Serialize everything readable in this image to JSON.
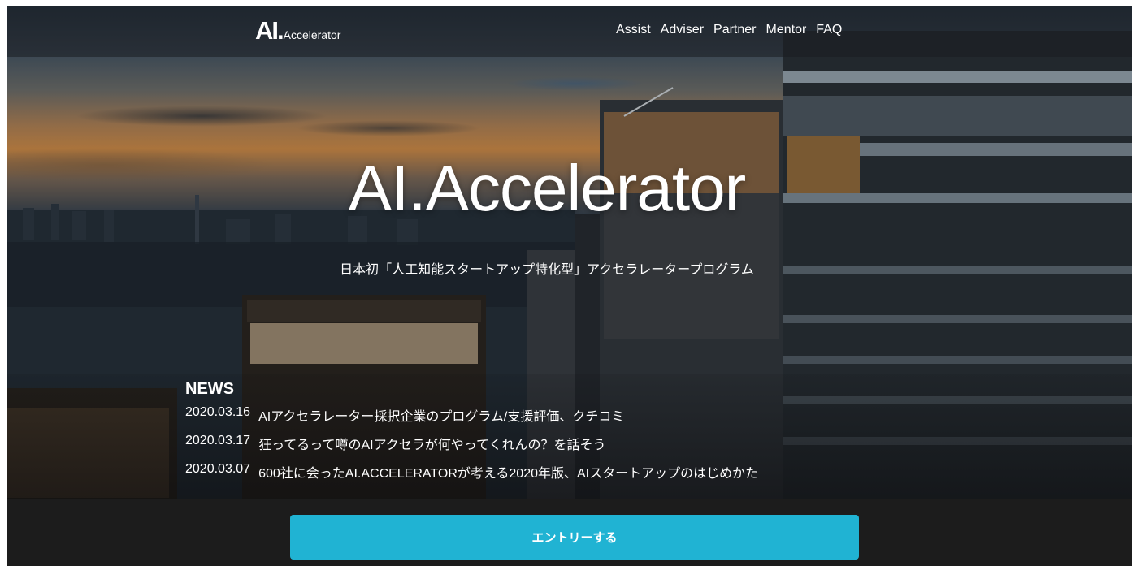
{
  "header": {
    "logo_main": "AI.",
    "logo_sub": "Accelerator",
    "nav": [
      "Assist",
      "Adviser",
      "Partner",
      "Mentor",
      "FAQ"
    ]
  },
  "hero": {
    "title": "AI.Accelerator",
    "subtitle": "日本初「人工知能スタートアップ特化型」アクセラレータープログラム"
  },
  "news": {
    "heading": "NEWS",
    "items": [
      {
        "date": "2020.03.16",
        "title": "AIアクセラレーター採択企業のプログラム/支援評価、クチコミ"
      },
      {
        "date": "2020.03.17",
        "title": "狂ってるって噂のAIアクセラが何やってくれんの？を話そう"
      },
      {
        "date": "2020.03.07",
        "title": "600社に会ったAI.ACCELERATORが考える2020年版、AIスタートアップのはじめかた"
      }
    ]
  },
  "entry": {
    "label": "エントリーする"
  },
  "colors": {
    "accent": "#20b3d3",
    "footer_bg": "#1c1c1c"
  }
}
